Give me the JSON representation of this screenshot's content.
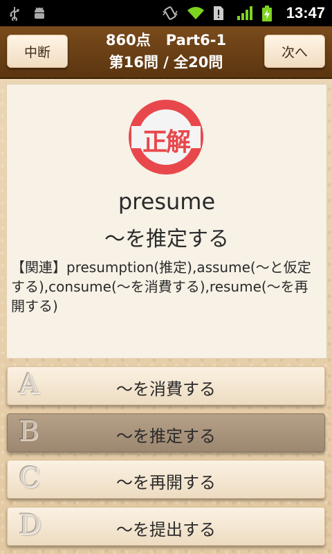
{
  "status_bar": {
    "time": "13:47",
    "left_icons": [
      "usb-icon",
      "android-debug-icon"
    ],
    "right_icons": [
      "vibrate-icon",
      "wifi-icon",
      "sim-alert-icon",
      "signal-icon",
      "battery-charging-icon"
    ]
  },
  "header": {
    "left_button": "中断",
    "right_button": "次へ",
    "score": "860点",
    "part": "Part6-1",
    "progress": "第16問 / 全20問"
  },
  "result": {
    "stamp_text": "正解",
    "stamp_color": "#e8484c"
  },
  "question": {
    "word": "presume",
    "meaning": "～を推定する",
    "related": "【関連】presumption(推定),assume(～と仮定する),consume(～を消費する),resume(～を再開する)"
  },
  "answers": [
    {
      "letter": "A",
      "text": "～を消費する",
      "selected": false
    },
    {
      "letter": "B",
      "text": "～を推定する",
      "selected": true
    },
    {
      "letter": "C",
      "text": "～を再開する",
      "selected": false
    },
    {
      "letter": "D",
      "text": "～を提出する",
      "selected": false
    }
  ]
}
